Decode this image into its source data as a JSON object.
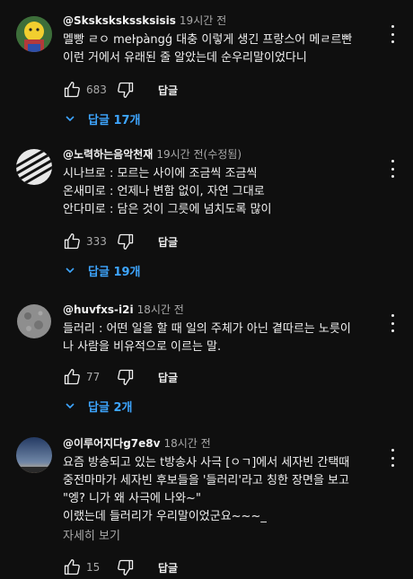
{
  "comments": [
    {
      "author": "@Skskskskssksisis",
      "time": "19시간 전",
      "lines": [
        "멜빵 ㄹㅇ meŀpàngǵ 대충 이렇게 생긴 프랑스어 메ㄹ르빤",
        "이런 거에서 유래된 줄 알았는데 순우리말이었다니"
      ],
      "likes": "683",
      "reply_label": "답글",
      "replies_label": "답글 17개",
      "avatar_icon": "cartoon-avatar"
    },
    {
      "author": "@노력하는음악천재",
      "time": "19시간 전(수정됨)",
      "lines": [
        "시나브로 : 모르는 사이에 조금씩 조금씩",
        "온새미로 : 언제나 변함 없이, 자연 그대로",
        "안다미로 : 담은 것이 그릇에 넘치도록 많이"
      ],
      "likes": "333",
      "reply_label": "답글",
      "replies_label": "답글 19개",
      "avatar_icon": "piano-keys-avatar"
    },
    {
      "author": "@huvfxs-i2i",
      "time": "18시간 전",
      "lines": [
        "들러리 : 어떤 일을 할 때 일의 주체가 아닌 곁따르는 노릇이",
        "나 사람을 비유적으로 이르는 말."
      ],
      "likes": "77",
      "reply_label": "답글",
      "replies_label": "답글 2개",
      "avatar_icon": "moon-avatar"
    },
    {
      "author": "@이루어지다g7e8v",
      "time": "18시간 전",
      "lines": [
        "요즘 방송되고 있는 t방송사 사극 [ㅇㄱ]에서 세자빈 간택때",
        "중전마마가 세자빈 후보들을 '들러리'라고 칭한 장면을 보고",
        "\"엥? 니가 왜 사극에 나와~\"",
        "이랬는데 들러리가 우리말이었군요~~~_"
      ],
      "more_label": "자세히 보기",
      "likes": "15",
      "reply_label": "답글",
      "avatar_icon": "sky-avatar"
    }
  ],
  "colors": {
    "background": "#0f0f0f",
    "text": "#f1f1f1",
    "secondary": "#aaaaaa",
    "link": "#3ea6ff"
  }
}
